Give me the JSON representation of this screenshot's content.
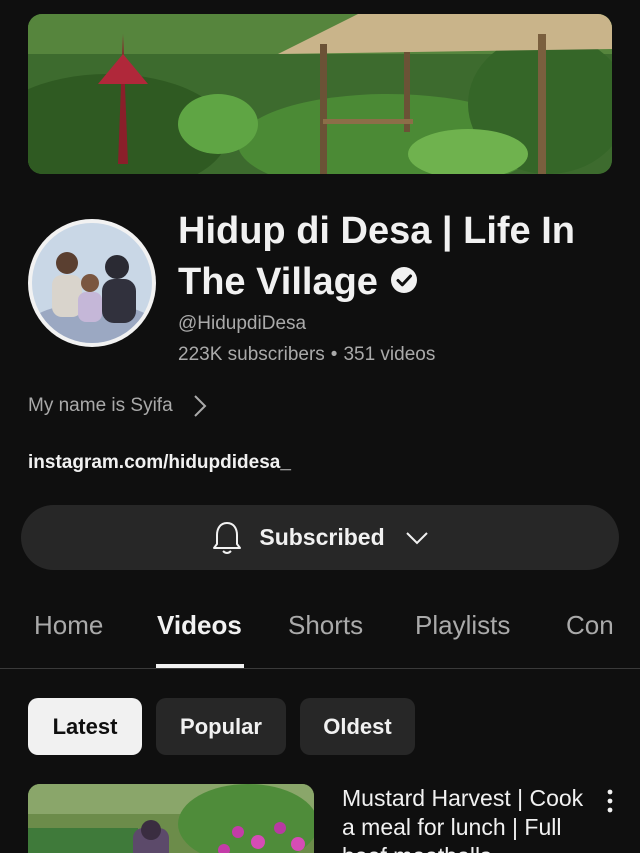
{
  "channel": {
    "title": "Hidup di Desa | Life In The Village",
    "handle": "@HidupdiDesa",
    "subscribers": "223K subscribers",
    "separator": "•",
    "videos": "351 videos",
    "description": "My name is Syifa",
    "link": "instagram.com/hidupdidesa_",
    "verified_icon": "verified-check-icon"
  },
  "subscribe": {
    "label": "Subscribed",
    "icon": "bell-icon"
  },
  "tabs": [
    {
      "label": "Home"
    },
    {
      "label": "Videos",
      "active": true
    },
    {
      "label": "Shorts"
    },
    {
      "label": "Playlists"
    },
    {
      "label": "Con"
    }
  ],
  "filters": [
    {
      "label": "Latest",
      "selected": true
    },
    {
      "label": "Popular"
    },
    {
      "label": "Oldest"
    }
  ],
  "video": {
    "title": "Mustard Harvest | Cook a meal for lunch | Full beef meatballs"
  },
  "colors": {
    "background": "#0f0f0f",
    "surface": "#272727",
    "text_primary": "#f1f1f1",
    "text_secondary": "#aaaaaa"
  }
}
